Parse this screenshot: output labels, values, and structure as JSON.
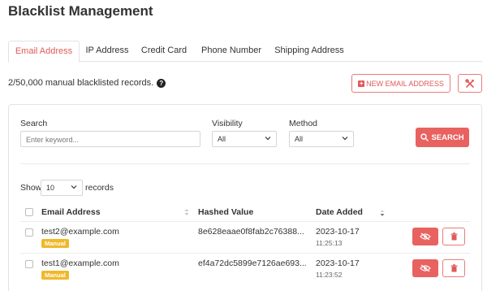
{
  "page": {
    "title": "Blacklist Management"
  },
  "tabs": [
    {
      "label": "Email Address",
      "active": true
    },
    {
      "label": "IP Address",
      "active": false
    },
    {
      "label": "Credit Card",
      "active": false
    },
    {
      "label": "Phone Number",
      "active": false
    },
    {
      "label": "Shipping Address",
      "active": false
    }
  ],
  "summary": {
    "count_text": "2/50,000 manual blacklisted records."
  },
  "toolbar": {
    "new_button_label": "NEW EMAIL ADDRESS"
  },
  "filters": {
    "search_label": "Search",
    "search_placeholder": "Enter keyword...",
    "search_value": "",
    "visibility_label": "Visibility",
    "visibility_value": "All",
    "method_label": "Method",
    "method_value": "All",
    "search_button_label": "SEARCH"
  },
  "paging": {
    "show_label": "Show",
    "page_size": "10",
    "records_label": "records"
  },
  "table": {
    "columns": [
      "Email Address",
      "Hashed Value",
      "Date Added"
    ],
    "rows": [
      {
        "email": "test2@example.com",
        "badge": "Manual",
        "hash": "8e628eaae0f8fab2c76388...",
        "date": "2023-10-17",
        "time": "11:25:13"
      },
      {
        "email": "test1@example.com",
        "badge": "Manual",
        "hash": "ef4a72dc5899e7126ae693...",
        "date": "2023-10-17",
        "time": "11:23:52"
      }
    ]
  },
  "colors": {
    "accent": "#e8625f",
    "badge": "#f0b92a"
  }
}
